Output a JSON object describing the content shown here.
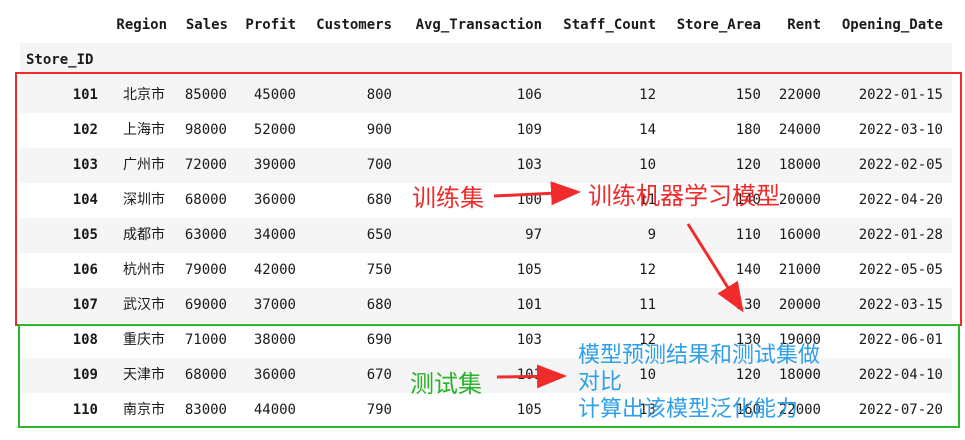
{
  "table": {
    "index_name": "Store_ID",
    "columns": [
      "Region",
      "Sales",
      "Profit",
      "Customers",
      "Avg_Transaction",
      "Staff_Count",
      "Store_Area",
      "Rent",
      "Opening_Date"
    ],
    "rows": [
      {
        "id": "101",
        "cells": [
          "北京市",
          "85000",
          "45000",
          "800",
          "106",
          "12",
          "150",
          "22000",
          "2022-01-15"
        ]
      },
      {
        "id": "102",
        "cells": [
          "上海市",
          "98000",
          "52000",
          "900",
          "109",
          "14",
          "180",
          "24000",
          "2022-03-10"
        ]
      },
      {
        "id": "103",
        "cells": [
          "广州市",
          "72000",
          "39000",
          "700",
          "103",
          "10",
          "120",
          "18000",
          "2022-02-05"
        ]
      },
      {
        "id": "104",
        "cells": [
          "深圳市",
          "68000",
          "36000",
          "680",
          "100",
          "11",
          "140",
          "20000",
          "2022-04-20"
        ]
      },
      {
        "id": "105",
        "cells": [
          "成都市",
          "63000",
          "34000",
          "650",
          "97",
          "9",
          "110",
          "16000",
          "2022-01-28"
        ]
      },
      {
        "id": "106",
        "cells": [
          "杭州市",
          "79000",
          "42000",
          "750",
          "105",
          "12",
          "140",
          "21000",
          "2022-05-05"
        ]
      },
      {
        "id": "107",
        "cells": [
          "武汉市",
          "69000",
          "37000",
          "680",
          "101",
          "11",
          "130",
          "20000",
          "2022-03-15"
        ]
      },
      {
        "id": "108",
        "cells": [
          "重庆市",
          "71000",
          "38000",
          "690",
          "103",
          "12",
          "130",
          "19000",
          "2022-06-01"
        ]
      },
      {
        "id": "109",
        "cells": [
          "天津市",
          "68000",
          "36000",
          "670",
          "101",
          "10",
          "120",
          "18000",
          "2022-04-10"
        ]
      },
      {
        "id": "110",
        "cells": [
          "南京市",
          "83000",
          "44000",
          "790",
          "105",
          "13",
          "160",
          "22000",
          "2022-07-20"
        ]
      }
    ]
  },
  "annotations": {
    "train_label": "训练集",
    "train_target": "训练机器学习模型",
    "test_label": "测试集",
    "test_target_line1": "模型预测结果和测试集做",
    "test_target_line2": "对比",
    "test_target_line3": "计算出该模型泛化能力"
  },
  "colors": {
    "train": "#ef2b2b",
    "test_box": "#2db52d",
    "test_label": "#29b329",
    "test_target": "#2f9fe8",
    "row_shade": "#f5f5f5"
  }
}
